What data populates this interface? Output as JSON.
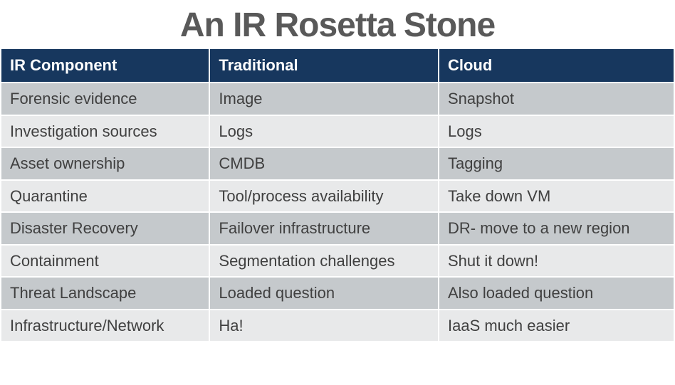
{
  "title": "An IR Rosetta Stone",
  "headers": [
    "IR Component",
    "Traditional",
    "Cloud"
  ],
  "rows": [
    [
      "Forensic evidence",
      "Image",
      "Snapshot"
    ],
    [
      "Investigation sources",
      "Logs",
      "Logs"
    ],
    [
      "Asset ownership",
      "CMDB",
      "Tagging"
    ],
    [
      "Quarantine",
      "Tool/process availability",
      "Take down VM"
    ],
    [
      "Disaster Recovery",
      "Failover infrastructure",
      "DR- move to a new region"
    ],
    [
      "Containment",
      "Segmentation challenges",
      "Shut it down!"
    ],
    [
      "Threat Landscape",
      "Loaded question",
      "Also loaded question"
    ],
    [
      "Infrastructure/Network",
      "Ha!",
      "IaaS much easier"
    ]
  ]
}
